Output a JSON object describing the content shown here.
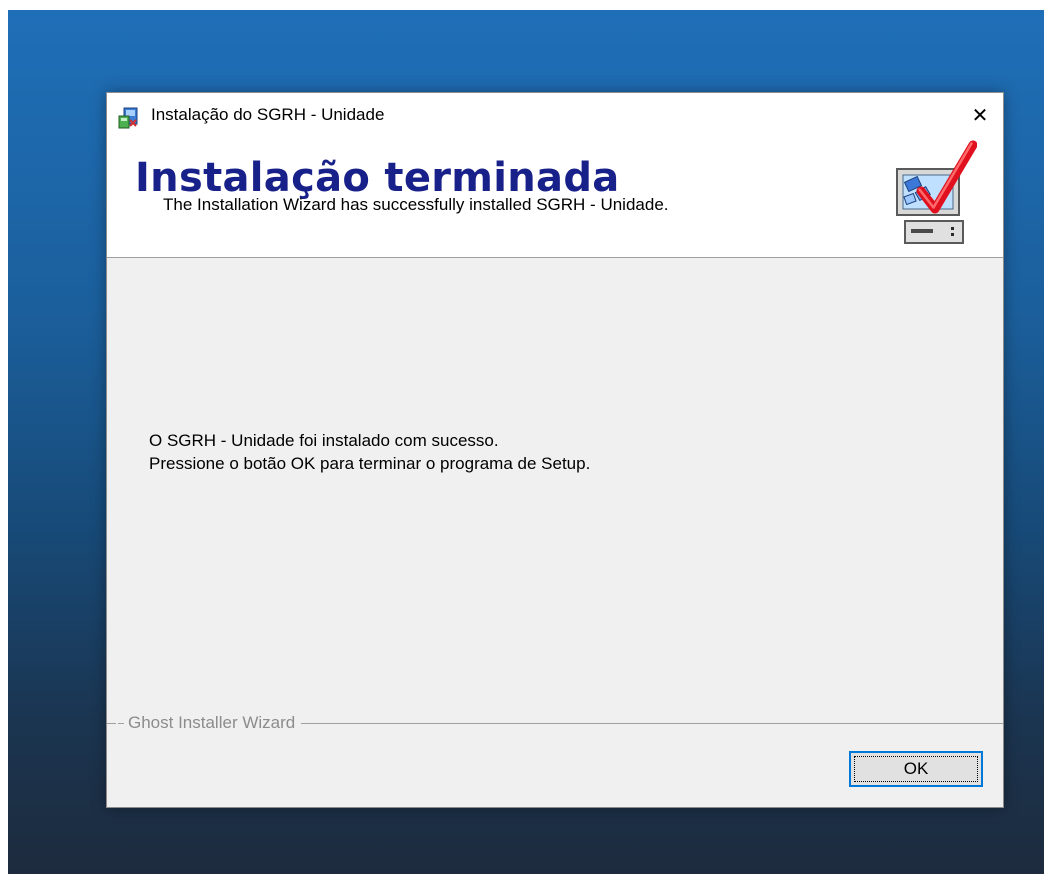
{
  "window": {
    "title": "Instalação do SGRH - Unidade",
    "app_icon": "installer-icon",
    "close_icon": "close-icon",
    "close_glyph": "✕"
  },
  "header": {
    "title": "Instalação terminada",
    "subtitle": "The Installation Wizard has successfully installed SGRH - Unidade.",
    "graphic": "computer-checkmark-icon"
  },
  "message": {
    "line1": "O SGRH - Unidade foi instalado com sucesso.",
    "line2": "Pressione o botão OK para terminar o programa de Setup."
  },
  "footer": {
    "group_label": "Ghost Installer Wizard",
    "ok_label": "OK"
  },
  "colors": {
    "header_title": "#18208a",
    "focus_border": "#0078d7",
    "check_red": "#e0101e"
  }
}
